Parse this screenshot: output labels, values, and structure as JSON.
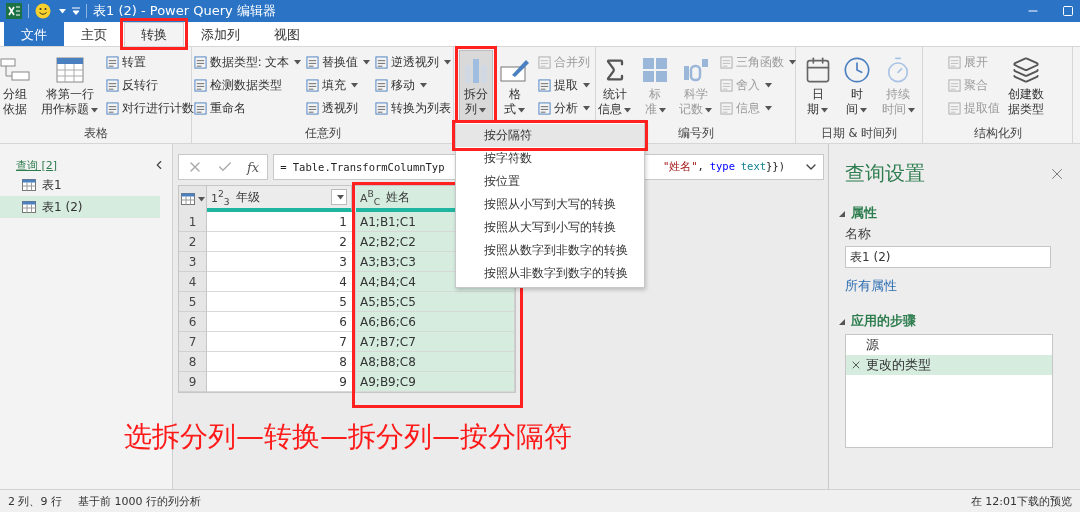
{
  "window": {
    "title": "表1 (2) - Power Query 编辑器"
  },
  "tabs": [
    {
      "label": "文件",
      "kind": "file",
      "selected": false,
      "highlighted": false
    },
    {
      "label": "主页",
      "kind": "tab",
      "selected": false,
      "highlighted": false
    },
    {
      "label": "转换",
      "kind": "tab",
      "selected": true,
      "highlighted": true
    },
    {
      "label": "添加列",
      "kind": "tab",
      "selected": false,
      "highlighted": false
    },
    {
      "label": "视图",
      "kind": "tab",
      "selected": false,
      "highlighted": false
    }
  ],
  "ribbon": {
    "groups": [
      {
        "label": "表格",
        "items": [
          {
            "kind": "large",
            "lines": [
              "分组",
              "依据"
            ],
            "caret": false,
            "disabled": false,
            "pressed": false,
            "highlighted": false
          },
          {
            "kind": "large",
            "lines": [
              "将第一行",
              "用作标题"
            ],
            "caret": true,
            "disabled": false,
            "pressed": false,
            "highlighted": false
          },
          {
            "kind": "stack",
            "rows": [
              {
                "label": "转置",
                "caret": false,
                "disabled": false
              },
              {
                "label": "反转行",
                "caret": false,
                "disabled": false
              },
              {
                "label": "对行进行计数",
                "caret": false,
                "disabled": false
              }
            ]
          }
        ]
      },
      {
        "label": "任意列",
        "items": [
          {
            "kind": "stack",
            "rows": [
              {
                "label": "数据类型: 文本",
                "caret": true,
                "disabled": false
              },
              {
                "label": "检测数据类型",
                "caret": false,
                "disabled": false
              },
              {
                "label": "重命名",
                "caret": false,
                "disabled": false
              }
            ]
          },
          {
            "kind": "stack",
            "rows": [
              {
                "label": "替换值",
                "caret": true,
                "disabled": false
              },
              {
                "label": "填充",
                "caret": true,
                "disabled": false
              },
              {
                "label": "透视列",
                "caret": false,
                "disabled": false
              }
            ]
          },
          {
            "kind": "stack",
            "rows": [
              {
                "label": "逆透视列",
                "caret": true,
                "disabled": false
              },
              {
                "label": "移动",
                "caret": true,
                "disabled": false
              },
              {
                "label": "转换为列表",
                "caret": false,
                "disabled": false
              }
            ]
          }
        ]
      },
      {
        "items": [
          {
            "kind": "large",
            "lines": [
              "拆分",
              "列"
            ],
            "caret": true,
            "disabled": false,
            "pressed": true,
            "highlighted": true
          },
          {
            "kind": "large",
            "lines": [
              "格",
              "式"
            ],
            "caret": true,
            "disabled": false,
            "pressed": false,
            "highlighted": false
          },
          {
            "kind": "stack",
            "rows": [
              {
                "label": "合并列",
                "caret": false,
                "disabled": true
              },
              {
                "label": "提取",
                "caret": true,
                "disabled": false
              },
              {
                "label": "分析",
                "caret": true,
                "disabled": false
              }
            ]
          }
        ]
      },
      {
        "label": "编号列",
        "items": [
          {
            "kind": "large",
            "lines": [
              "统计",
              "信息"
            ],
            "caret": true,
            "disabled": false,
            "pressed": false,
            "highlighted": false
          },
          {
            "kind": "large",
            "lines": [
              "标",
              "准"
            ],
            "caret": true,
            "disabled": true,
            "pressed": false,
            "highlighted": false
          },
          {
            "kind": "large",
            "lines": [
              "科学",
              "记数"
            ],
            "caret": true,
            "disabled": true,
            "pressed": false,
            "highlighted": false
          },
          {
            "kind": "stack",
            "rows": [
              {
                "label": "三角函数",
                "caret": true,
                "disabled": true
              },
              {
                "label": "舍入",
                "caret": true,
                "disabled": true
              },
              {
                "label": "信息",
                "caret": true,
                "disabled": true
              }
            ]
          }
        ]
      },
      {
        "label": "日期 & 时间列",
        "items": [
          {
            "kind": "large",
            "lines": [
              "日",
              "期"
            ],
            "caret": true,
            "disabled": false,
            "pressed": false,
            "highlighted": false
          },
          {
            "kind": "large",
            "lines": [
              "时",
              "间"
            ],
            "caret": true,
            "disabled": false,
            "pressed": false,
            "highlighted": false
          },
          {
            "kind": "large",
            "lines": [
              "持续",
              "时间"
            ],
            "caret": true,
            "disabled": true,
            "pressed": false,
            "highlighted": false
          }
        ]
      },
      {
        "label": "结构化列",
        "items": [
          {
            "kind": "stack",
            "rows": [
              {
                "label": "展开",
                "caret": false,
                "disabled": true
              },
              {
                "label": "聚合",
                "caret": false,
                "disabled": true
              },
              {
                "label": "提取值",
                "caret": false,
                "disabled": true
              }
            ]
          },
          {
            "kind": "large",
            "lines": [
              "创建数",
              "据类型"
            ],
            "caret": false,
            "disabled": false,
            "pressed": false,
            "highlighted": false
          }
        ]
      }
    ]
  },
  "queries": {
    "header": "查询 [2]",
    "items": [
      {
        "label": "表1",
        "selected": false
      },
      {
        "label": "表1 (2)",
        "selected": true
      }
    ]
  },
  "formula": {
    "fx": "fx",
    "start": "= Table.TransformColumnTyp",
    "end": [
      {
        "text": "\"姓名\"",
        "kind": "string"
      },
      {
        "text": ",",
        "kind": "plain"
      },
      {
        "text": "type",
        "kind": "keyword"
      },
      {
        "text": "text",
        "kind": "type"
      },
      {
        "text": "}})",
        "kind": "plain"
      }
    ]
  },
  "table": {
    "columns": [
      {
        "label": "年级",
        "type_label": "1$^{2}$$_{3}$",
        "selected": false,
        "highlighted": false
      },
      {
        "label": "姓名",
        "type_label": "A$^{B}$$_{C}$",
        "selected": true,
        "highlighted": true
      }
    ],
    "rows": [
      {
        "number": "1",
        "cells": [
          "1",
          "A1;B1;C1"
        ]
      },
      {
        "number": "2",
        "cells": [
          "2",
          "A2;B2;C2"
        ]
      },
      {
        "number": "3",
        "cells": [
          "3",
          "A3;B3;C3"
        ]
      },
      {
        "number": "4",
        "cells": [
          "4",
          "A4;B4;C4"
        ]
      },
      {
        "number": "5",
        "cells": [
          "5",
          "A5;B5;C5"
        ]
      },
      {
        "number": "6",
        "cells": [
          "6",
          "A6;B6;C6"
        ]
      },
      {
        "number": "7",
        "cells": [
          "7",
          "A7;B7;C7"
        ]
      },
      {
        "number": "8",
        "cells": [
          "8",
          "A8;B8;C8"
        ]
      },
      {
        "number": "9",
        "cells": [
          "9",
          "A9;B9;C9"
        ]
      }
    ]
  },
  "menu": {
    "items": [
      {
        "label": "按分隔符",
        "selected": true,
        "highlighted": true
      },
      {
        "label": "按字符数",
        "selected": false,
        "highlighted": false
      },
      {
        "label": "按位置",
        "selected": false,
        "highlighted": false
      },
      {
        "label": "按照从小写到大写的转换",
        "selected": false,
        "highlighted": false
      },
      {
        "label": "按照从大写到小写的转换",
        "selected": false,
        "highlighted": false
      },
      {
        "label": "按照从数字到非数字的转换",
        "selected": false,
        "highlighted": false
      },
      {
        "label": "按照从非数字到数字的转换",
        "selected": false,
        "highlighted": false
      }
    ]
  },
  "settings": {
    "title": "查询设置",
    "properties": {
      "heading": "属性",
      "name_label": "名称",
      "name_value": "表1 (2)",
      "link": "所有属性"
    },
    "steps": {
      "heading": "应用的步骤",
      "items": [
        {
          "label": "源",
          "selected": false
        },
        {
          "label": "更改的类型",
          "selected": true
        }
      ]
    }
  },
  "status_bar": {
    "left": [
      "2 列、9 行",
      "基于前 1000 行的列分析"
    ],
    "right": "在 12:01下载的预览"
  },
  "annotation": {
    "caption": "选拆分列—转换—拆分列—按分隔符"
  }
}
